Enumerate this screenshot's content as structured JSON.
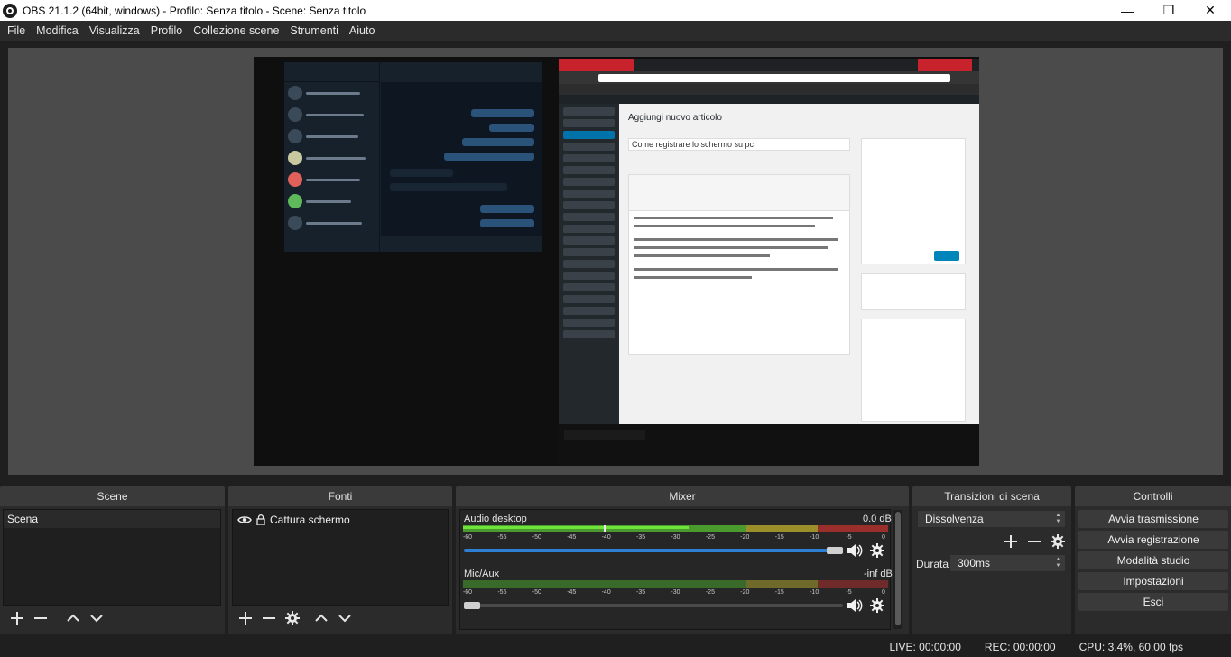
{
  "window": {
    "title": "OBS 21.1.2 (64bit, windows) - Profilo: Senza titolo - Scene: Senza titolo",
    "minimize_icon": "—",
    "restore_icon": "❐",
    "close_icon": "✕"
  },
  "menu": [
    "File",
    "Modifica",
    "Visualizza",
    "Profilo",
    "Collezione scene",
    "Strumenti",
    "Aiuto"
  ],
  "preview": {
    "captured_browser_title": "Aggiungi nuovo articolo",
    "captured_post_title": "Come registrare lo schermo su pc"
  },
  "docks": {
    "scenes": "Scene",
    "sources": "Fonti",
    "mixer": "Mixer",
    "transitions": "Transizioni di scena",
    "controls": "Controlli"
  },
  "scenes": {
    "items": [
      "Scena"
    ]
  },
  "sources": {
    "items": [
      {
        "name": "Cattura schermo",
        "visible": true,
        "locked": false
      }
    ]
  },
  "mixer": {
    "ticks": [
      "-60",
      "-55",
      "-50",
      "-45",
      "-40",
      "-35",
      "-30",
      "-25",
      "-20",
      "-15",
      "-10",
      "-5",
      "0"
    ],
    "channels": [
      {
        "name": "Audio desktop",
        "level": "0.0 dB",
        "volume_fraction": 1.0,
        "active": true
      },
      {
        "name": "Mic/Aux",
        "level": "-inf dB",
        "volume_fraction": 0.0,
        "active": false
      }
    ]
  },
  "transitions": {
    "selected": "Dissolvenza",
    "duration_label": "Durata",
    "duration_value": "300ms"
  },
  "controls": {
    "buttons": [
      "Avvia trasmissione",
      "Avvia registrazione",
      "Modalità studio",
      "Impostazioni",
      "Esci"
    ]
  },
  "status": {
    "live": "LIVE: 00:00:00",
    "rec": "REC: 00:00:00",
    "cpu": "CPU: 3.4%, 60.00 fps"
  },
  "colors": {
    "accent_blue": "#2d7fd3",
    "meter_green": "#4b9a2e",
    "meter_yellow": "#9a8f2b",
    "meter_red": "#9a2e2b"
  }
}
